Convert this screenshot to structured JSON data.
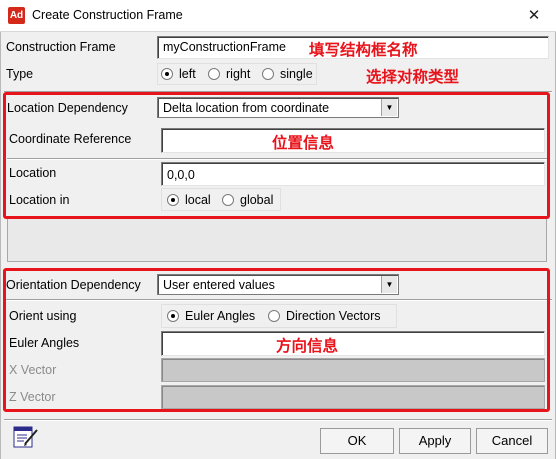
{
  "window": {
    "icon_text": "Ad",
    "title": "Create Construction Frame",
    "close_glyph": "✕"
  },
  "form": {
    "frame_label": "Construction Frame",
    "frame_value": "myConstructionFrame",
    "type_label": "Type",
    "type_options": [
      "left",
      "right",
      "single"
    ],
    "type_selected": "left"
  },
  "location": {
    "dependency_label": "Location Dependency",
    "dependency_value": "Delta location from coordinate",
    "coord_ref_label": "Coordinate Reference",
    "coord_ref_value": "",
    "location_label": "Location",
    "location_value": "0,0,0",
    "location_in_label": "Location in",
    "location_in_options": [
      "local",
      "global"
    ],
    "location_in_selected": "local"
  },
  "orientation": {
    "dependency_label": "Orientation Dependency",
    "dependency_value": "User entered values",
    "orient_using_label": "Orient using",
    "orient_using_options": [
      "Euler Angles",
      "Direction Vectors"
    ],
    "orient_using_selected": "Euler Angles",
    "euler_label": "Euler Angles",
    "euler_value": "",
    "x_vector_label": "X Vector",
    "z_vector_label": "Z Vector"
  },
  "annotations": {
    "name": "填写结构框名称",
    "type": "选择对称类型",
    "location": "位置信息",
    "orientation": "方向信息"
  },
  "buttons": {
    "ok": "OK",
    "apply": "Apply",
    "cancel": "Cancel"
  },
  "icons": {
    "app": "adams-app-icon",
    "close": "close-icon",
    "edit": "edit-notes-icon"
  },
  "colors": {
    "annotation": "#e8141c",
    "app_icon": "#d4281b",
    "disabled_field": "#c8c8c8"
  }
}
